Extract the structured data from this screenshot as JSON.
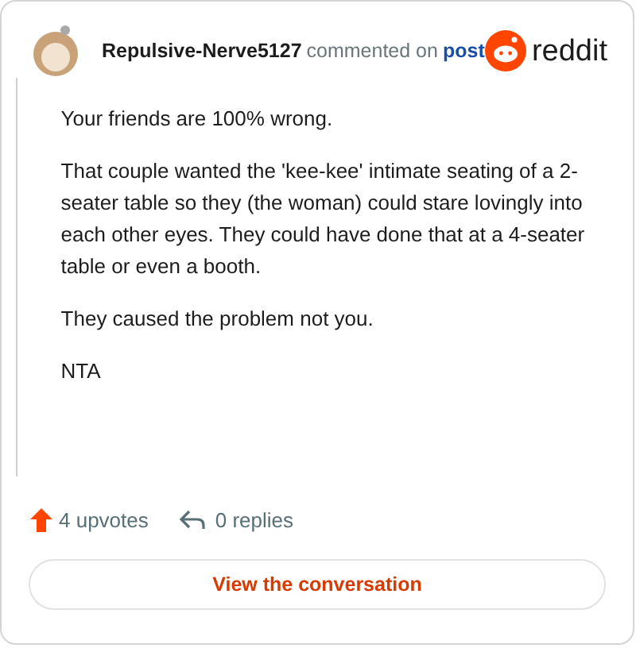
{
  "header": {
    "username": "Repulsive-Nerve5127",
    "action": "commented on",
    "link": "post",
    "brand": "reddit"
  },
  "paragraphs": [
    "Your friends are 100% wrong.",
    "That couple wanted the 'kee-kee' intimate seating of a 2-seater table so they (the woman) could stare lovingly into each other eyes. They could have done that at a 4-seater table or even a booth.",
    "They caused the problem not you.",
    "NTA"
  ],
  "footer": {
    "upvotes": "4 upvotes",
    "replies": "0 replies"
  },
  "button": "View the conversation"
}
